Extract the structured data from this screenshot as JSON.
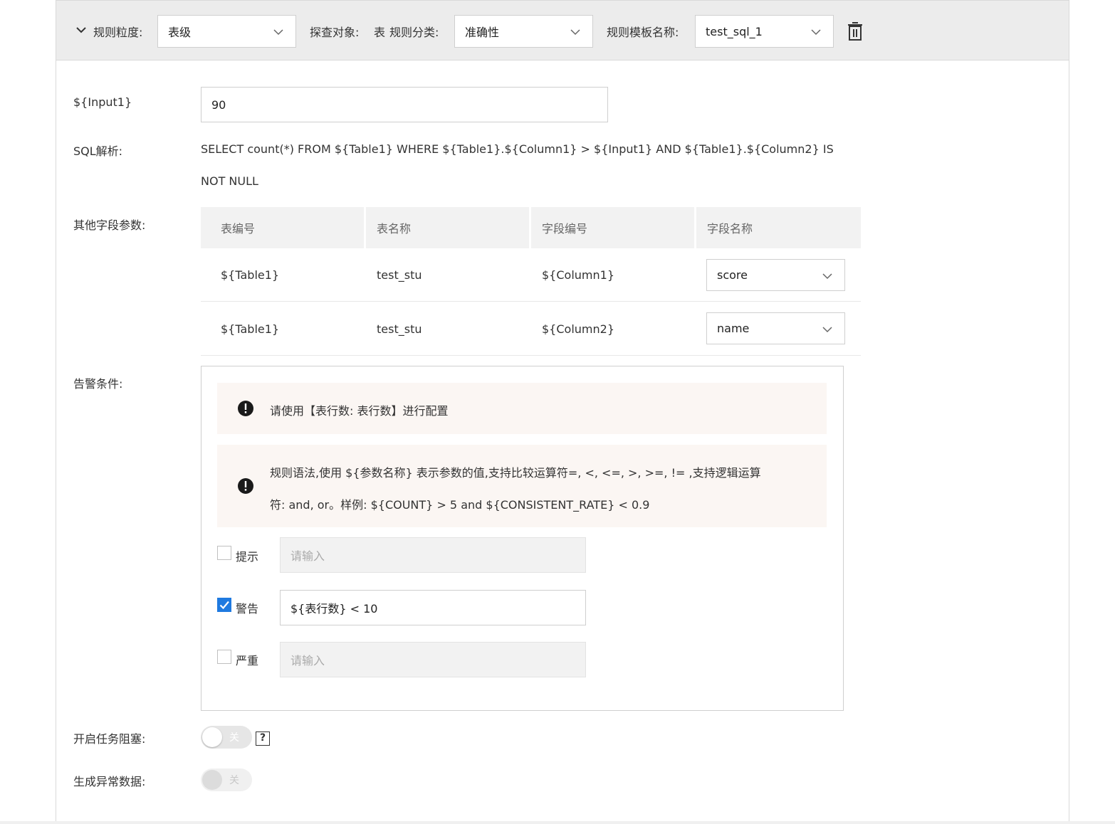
{
  "header": {
    "granularity_label": "规则粒度:",
    "granularity_value": "表级",
    "target_label": "探查对象:",
    "target_value": "表",
    "category_label": "规则分类:",
    "category_value": "准确性",
    "template_label": "规则模板名称:",
    "template_value": "test_sql_1"
  },
  "form": {
    "input1_label": "${Input1}",
    "input1_value": "90",
    "sql_label": "SQL解析:",
    "sql_line1": "SELECT count(*) FROM ${Table1} WHERE ${Table1}.${Column1} > ${Input1} AND ${Table1}.${Column2} IS",
    "sql_line2": "NOT NULL",
    "other_params_label": "其他字段参数:",
    "alert_label": "告警条件:",
    "block_label": "开启任务阻塞:",
    "abnormal_label": "生成异常数据:"
  },
  "params_table": {
    "headers": [
      "表编号",
      "表名称",
      "字段编号",
      "字段名称"
    ],
    "rows": [
      {
        "table_id": "${Table1}",
        "table_name": "test_stu",
        "column_id": "${Column1}",
        "column_name": "score"
      },
      {
        "table_id": "${Table1}",
        "table_name": "test_stu",
        "column_id": "${Column2}",
        "column_name": "name"
      }
    ]
  },
  "alert": {
    "notice1": "请使用【表行数: 表行数】进行配置",
    "notice2_line1": "规则语法,使用 ${参数名称} 表示参数的值,支持比较运算符=, <, <=, >, >=, != ,支持逻辑运算",
    "notice2_line2": "符: and, or。样例: ${COUNT} > 5 and ${CONSISTENT_RATE} < 0.9",
    "levels": [
      {
        "label": "提示",
        "checked": false,
        "value": "",
        "placeholder": "请输入"
      },
      {
        "label": "警告",
        "checked": true,
        "value": "${表行数} < 10",
        "placeholder": "请输入"
      },
      {
        "label": "严重",
        "checked": false,
        "value": "",
        "placeholder": "请输入"
      }
    ]
  },
  "switches": {
    "block_state": "关",
    "abnormal_state": "关",
    "help_glyph": "?"
  },
  "colors": {
    "accent": "#1f7ae0",
    "header_bg": "#ececec",
    "notice_bg": "#fbf6f3"
  }
}
